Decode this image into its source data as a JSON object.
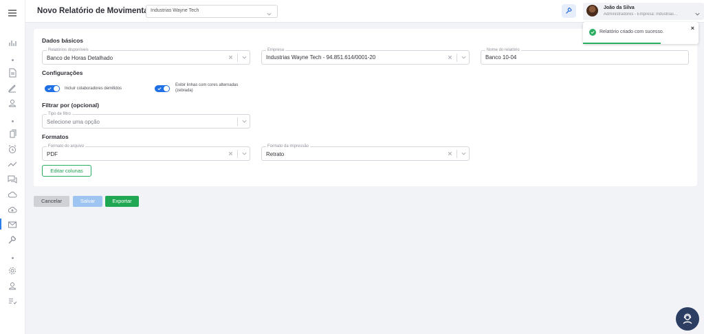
{
  "header": {
    "title": "Novo Relatório de Movimentações",
    "company_select": "Industrias Wayne Tech"
  },
  "user": {
    "name": "João da Silva",
    "role": "Administradores - Empresa: Industrias..."
  },
  "toast": {
    "message": "Relatório criado com sucesso.",
    "close": "×",
    "progress_fraction": 0.67
  },
  "sections": {
    "basic": "Dados básicos",
    "config": "Configurações",
    "filter": "Filtrar por (opcional)",
    "formats": "Formatos"
  },
  "fields": {
    "report": {
      "label": "Relatórios disponíveis",
      "value": "Banco de Horas Detalhado"
    },
    "company": {
      "label": "Empresa",
      "value": "Industrias Wayne Tech - 94.851.614/0001-20"
    },
    "report_name": {
      "label": "Nome do relatório",
      "value": "Banco 10-04"
    },
    "filter_type": {
      "label": "Tipo de filtro",
      "placeholder": "Selecione uma opção"
    },
    "file_format": {
      "label": "Formato do arquivo",
      "value": "PDF"
    },
    "print_format": {
      "label": "Formato da impressão",
      "value": "Retrato"
    }
  },
  "toggles": {
    "include_dismissed": {
      "label": "Incluir colaboradores demitidos",
      "on": true
    },
    "zebra": {
      "label_line1": "Exibir linhas com cores alternadas",
      "label_line2": "(zebrada)",
      "on": true
    }
  },
  "buttons": {
    "edit_columns": "Editar colunas",
    "cancel": "Cancelar",
    "save": "Salvar",
    "export": "Exportar"
  },
  "colors": {
    "primary": "#1f6fe5",
    "success": "#1fa752",
    "save_disabled": "#9ec4f2",
    "fab": "#2c3e64"
  },
  "sidebar_icons": [
    "menu-icon",
    "chart-icon",
    "document-icon",
    "pen-icon",
    "user-icon",
    "copy-icon",
    "alarm-icon",
    "trend-icon",
    "chat-icon",
    "cloud-icon",
    "cloud-upload-icon",
    "mail-icon",
    "wrench-icon",
    "gear-icon",
    "person-icon",
    "checklist-icon"
  ]
}
